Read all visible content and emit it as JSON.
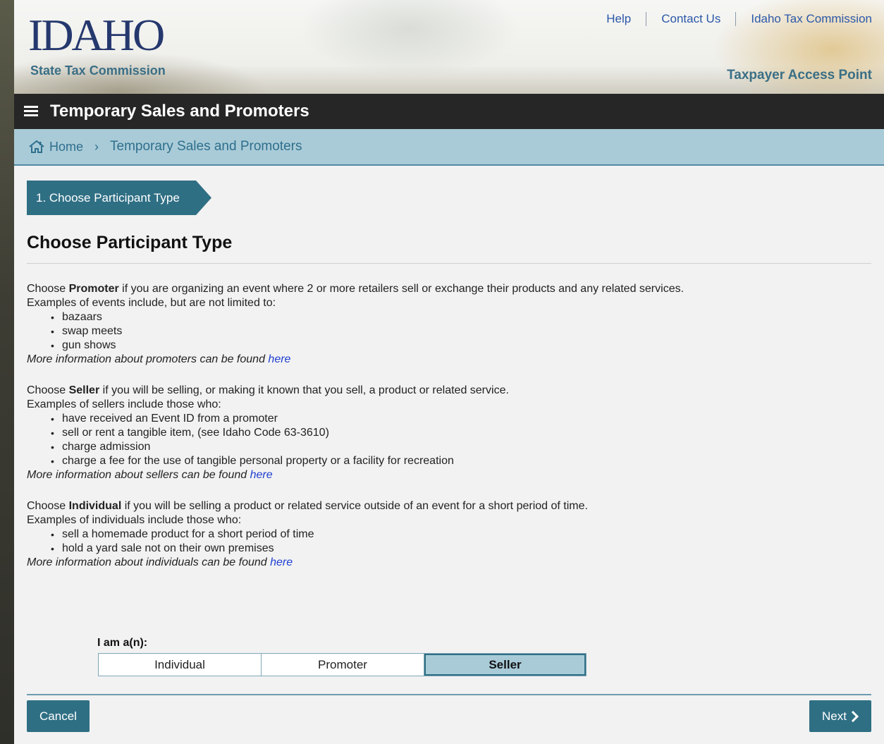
{
  "header": {
    "logo_word": "IDAHO",
    "logo_sub": "State Tax Commission",
    "links": [
      "Help",
      "Contact Us",
      "Idaho Tax Commission"
    ],
    "app_name": "Taxpayer Access Point"
  },
  "titlebar": {
    "title": "Temporary Sales and Promoters",
    "menu_icon": "hamburger-icon"
  },
  "breadcrumb": {
    "home_icon": "home-icon",
    "home": "Home",
    "separator": "›",
    "current": "Temporary Sales and Promoters"
  },
  "step": {
    "label": "1. Choose Participant Type"
  },
  "page_title": "Choose Participant Type",
  "promoter": {
    "intro_pre": "Choose ",
    "intro_bold": "Promoter",
    "intro_post": " if you are organizing an event where 2 or more retailers sell or exchange their products and any related services.",
    "examples_label": "Examples of events include, but are not limited to:",
    "items": [
      "bazaars",
      "swap meets",
      "gun shows"
    ],
    "more_text": "More information about promoters can be found ",
    "more_link": "here"
  },
  "seller": {
    "intro_pre": "Choose ",
    "intro_bold": "Seller",
    "intro_post": " if you will be selling, or making it known that you sell, a product or related service.",
    "examples_label": "Examples of sellers include those who:",
    "items": [
      "have received an Event ID from a promoter",
      "sell or rent a tangible item, (see Idaho Code 63-3610)",
      "charge admission",
      "charge a fee for the use of tangible personal property or a facility for recreation"
    ],
    "more_text": "More information about sellers can be found ",
    "more_link": "here"
  },
  "individual": {
    "intro_pre": "Choose ",
    "intro_bold": "Individual",
    "intro_post": " if you will be selling a product or related service outside of an event for a short period of time.",
    "examples_label": "Examples of individuals include those who:",
    "items": [
      "sell a homemade product for a short period of time",
      "hold a yard sale not on their own premises"
    ],
    "more_text": "More information about individuals can be found ",
    "more_link": "here"
  },
  "chooser": {
    "label": "I am a(n):",
    "options": [
      "Individual",
      "Promoter",
      "Seller"
    ],
    "selected": "Seller"
  },
  "footer": {
    "cancel": "Cancel",
    "next": "Next",
    "next_icon": "chevron-right-icon"
  },
  "colors": {
    "accent": "#2f6f84",
    "breadcrumb_bg": "#a9cbd8",
    "titlebar_bg": "#262626",
    "link": "#1f3fd1"
  }
}
